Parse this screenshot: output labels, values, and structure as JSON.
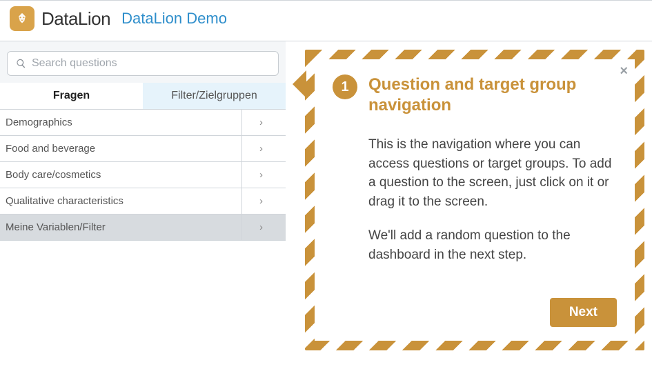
{
  "brand": {
    "name": "DataLion",
    "subtitle": "DataLion Demo"
  },
  "search": {
    "placeholder": "Search questions",
    "value": ""
  },
  "tabs": {
    "active": "Fragen",
    "inactive": "Filter/Zielgruppen"
  },
  "categories": [
    "Demographics",
    "Food and beverage",
    "Body care/cosmetics",
    "Qualitative characteristics",
    "Meine Variablen/Filter"
  ],
  "tour": {
    "step": "1",
    "title": "Question and target group navigation",
    "para1": "This is the navigation where you can access questions or target groups. To add a question to the screen, just click on it or drag it to the screen.",
    "para2": "We'll add a random question to the dashboard in the next step.",
    "next": "Next",
    "close": "×"
  },
  "colors": {
    "accent": "#c9923a",
    "link": "#2e8ecb"
  }
}
